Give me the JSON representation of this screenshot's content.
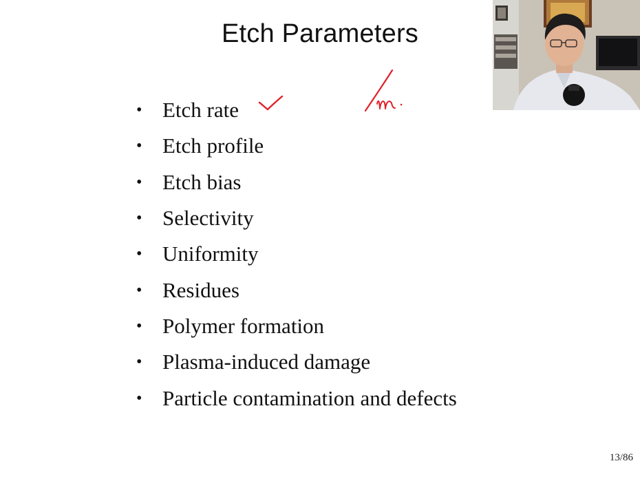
{
  "slide": {
    "title": "Etch Parameters",
    "bullet_char": "•",
    "bullets": [
      "Etch rate",
      "Etch profile",
      "Etch bias",
      "Selectivity",
      "Uniformity",
      "Residues",
      "Polymer formation",
      "Plasma-induced damage",
      "Particle contamination and defects"
    ],
    "page_number": "13/86"
  },
  "annotations": {
    "ink_color": "#e0202a"
  },
  "webcam": {
    "present": true
  }
}
